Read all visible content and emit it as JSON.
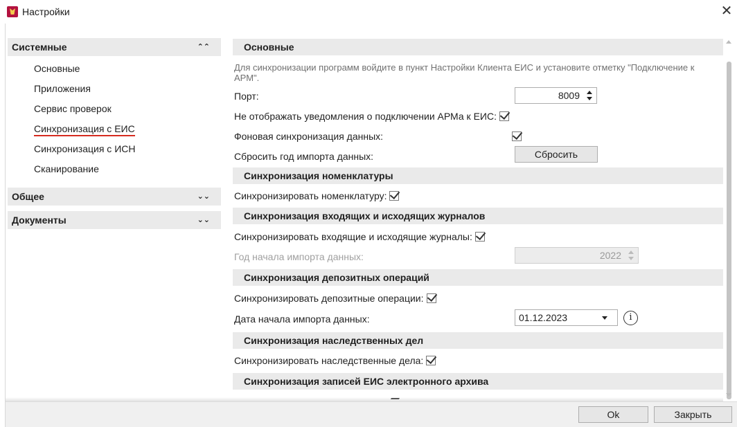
{
  "window": {
    "title": "Настройки",
    "app_icon": "app-logo-icon",
    "close_glyph": "✕"
  },
  "sidebar": {
    "groups": [
      {
        "label": "Системные",
        "expanded": true,
        "chevron": "⌃⌃",
        "items": [
          {
            "label": "Основные"
          },
          {
            "label": "Приложения"
          },
          {
            "label": "Сервис проверок"
          },
          {
            "label": "Синхронизация с ЕИС",
            "active": true
          },
          {
            "label": "Синхронизация с ИСН"
          },
          {
            "label": "Сканирование"
          }
        ]
      },
      {
        "label": "Общее",
        "expanded": false,
        "chevron": "⌄⌄"
      },
      {
        "label": "Документы",
        "expanded": false,
        "chevron": "⌄⌄"
      }
    ]
  },
  "main": {
    "basic": {
      "header": "Основные",
      "description": "Для синхронизации программ войдите в пункт Настройки Клиента ЕИС и установите отметку \"Подключение к АРМ\".",
      "port_label": "Порт:",
      "port_value": "8009",
      "no_notify_label": "Не отображать уведомления о подключении АРМа к ЕИС:",
      "no_notify_checked": true,
      "bg_sync_label": "Фоновая синхронизация данных:",
      "bg_sync_checked": true,
      "reset_label": "Сбросить год импорта данных:",
      "reset_button": "Сбросить"
    },
    "nomenclature": {
      "header": "Синхронизация номенклатуры",
      "sync_label": "Синхронизировать номенклатуру:",
      "sync_checked": true
    },
    "journals": {
      "header": "Синхронизация входящих и исходящих журналов",
      "sync_label": "Синхронизировать входящие и исходящие журналы:",
      "sync_checked": true,
      "year_label": "Год начала импорта данных:",
      "year_value": "2022",
      "year_disabled": true
    },
    "deposits": {
      "header": "Синхронизация депозитных операций",
      "sync_label": "Синхронизировать депозитные операции:",
      "sync_checked": true,
      "date_label": "Дата начала импорта данных:",
      "date_value": "01.12.2023",
      "info_glyph": "i"
    },
    "inheritance": {
      "header": "Синхронизация наследственных дел",
      "sync_label": "Синхронизировать наследственные дела:",
      "sync_checked": true
    },
    "archive": {
      "header": "Синхронизация записей ЕИС электронного архива"
    }
  },
  "footer": {
    "ok_label": "Ok",
    "close_label": "Закрыть"
  }
}
